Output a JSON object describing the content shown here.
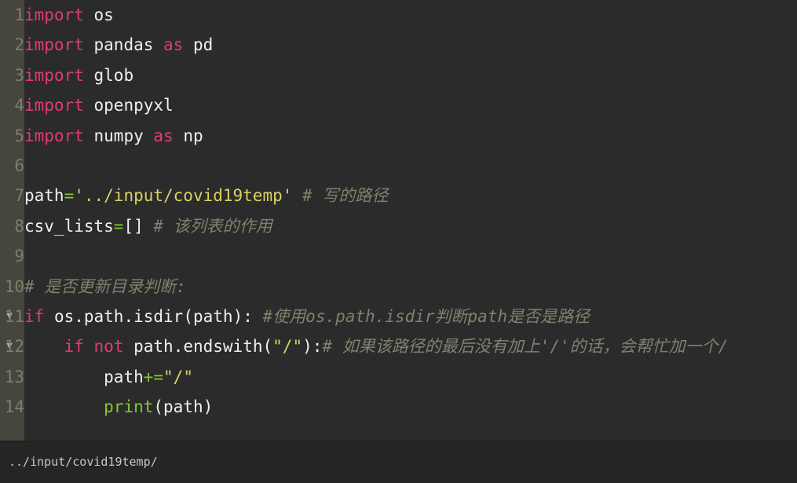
{
  "editor": {
    "language": "python",
    "theme": {
      "background": "#2b2b2b",
      "gutter_background": "#46453e",
      "line_number_color": "#7e7d6e",
      "default_text": "#e8e8e8",
      "keyword": "#e03c72",
      "string": "#d9d264",
      "operator": "#86c834",
      "function": "#86c834",
      "comment": "#82806e",
      "fold_arrow": "#b4b4b0"
    },
    "fold_arrow_glyph": "▼",
    "lines": [
      {
        "number": "1",
        "fold": false,
        "tokens": [
          {
            "t": "import",
            "c": "t-kw"
          },
          {
            "t": " ",
            "c": "t-id"
          },
          {
            "t": "os",
            "c": "t-id"
          }
        ]
      },
      {
        "number": "2",
        "fold": false,
        "tokens": [
          {
            "t": "import",
            "c": "t-kw"
          },
          {
            "t": " ",
            "c": "t-id"
          },
          {
            "t": "pandas",
            "c": "t-id"
          },
          {
            "t": " ",
            "c": "t-id"
          },
          {
            "t": "as",
            "c": "t-kw"
          },
          {
            "t": " ",
            "c": "t-id"
          },
          {
            "t": "pd",
            "c": "t-id"
          }
        ]
      },
      {
        "number": "3",
        "fold": false,
        "tokens": [
          {
            "t": "import",
            "c": "t-kw"
          },
          {
            "t": " ",
            "c": "t-id"
          },
          {
            "t": "glob",
            "c": "t-id"
          }
        ]
      },
      {
        "number": "4",
        "fold": false,
        "tokens": [
          {
            "t": "import",
            "c": "t-kw"
          },
          {
            "t": " ",
            "c": "t-id"
          },
          {
            "t": "openpyxl",
            "c": "t-id"
          }
        ]
      },
      {
        "number": "5",
        "fold": false,
        "tokens": [
          {
            "t": "import",
            "c": "t-kw"
          },
          {
            "t": " ",
            "c": "t-id"
          },
          {
            "t": "numpy",
            "c": "t-id"
          },
          {
            "t": " ",
            "c": "t-id"
          },
          {
            "t": "as",
            "c": "t-kw"
          },
          {
            "t": " ",
            "c": "t-id"
          },
          {
            "t": "np",
            "c": "t-id"
          }
        ]
      },
      {
        "number": "6",
        "fold": false,
        "tokens": []
      },
      {
        "number": "7",
        "fold": false,
        "tokens": [
          {
            "t": "path",
            "c": "t-id"
          },
          {
            "t": "=",
            "c": "t-op"
          },
          {
            "t": "'../input/covid19temp'",
            "c": "t-str"
          },
          {
            "t": " ",
            "c": "t-id"
          },
          {
            "t": "# 写的路径",
            "c": "t-com"
          }
        ]
      },
      {
        "number": "8",
        "fold": false,
        "tokens": [
          {
            "t": "csv_lists",
            "c": "t-id"
          },
          {
            "t": "=",
            "c": "t-op"
          },
          {
            "t": "[]",
            "c": "t-pun"
          },
          {
            "t": " ",
            "c": "t-id"
          },
          {
            "t": "# 该列表的作用",
            "c": "t-com"
          }
        ]
      },
      {
        "number": "9",
        "fold": false,
        "tokens": []
      },
      {
        "number": "10",
        "fold": false,
        "tokens": [
          {
            "t": "# 是否更新目录判断:",
            "c": "t-com"
          }
        ]
      },
      {
        "number": "11",
        "fold": true,
        "tokens": [
          {
            "t": "if",
            "c": "t-kw"
          },
          {
            "t": " ",
            "c": "t-id"
          },
          {
            "t": "os.path.isdir",
            "c": "t-id"
          },
          {
            "t": "(",
            "c": "t-pun"
          },
          {
            "t": "path",
            "c": "t-id"
          },
          {
            "t": ")",
            "c": "t-pun"
          },
          {
            "t": ":",
            "c": "t-pun"
          },
          {
            "t": " ",
            "c": "t-id"
          },
          {
            "t": "#使用os.path.isdir判断path是否是路径",
            "c": "t-com"
          }
        ]
      },
      {
        "number": "12",
        "fold": true,
        "tokens": [
          {
            "t": "    ",
            "c": "t-id"
          },
          {
            "t": "if",
            "c": "t-kw"
          },
          {
            "t": " ",
            "c": "t-id"
          },
          {
            "t": "not",
            "c": "t-kw"
          },
          {
            "t": " ",
            "c": "t-id"
          },
          {
            "t": "path.endswith",
            "c": "t-id"
          },
          {
            "t": "(",
            "c": "t-pun"
          },
          {
            "t": "\"/\"",
            "c": "t-str"
          },
          {
            "t": ")",
            "c": "t-pun"
          },
          {
            "t": ":",
            "c": "t-pun"
          },
          {
            "t": "# 如果该路径的最后没有加上'/'的话，会帮忙加一个/",
            "c": "t-com"
          }
        ]
      },
      {
        "number": "13",
        "fold": false,
        "tokens": [
          {
            "t": "        ",
            "c": "t-id"
          },
          {
            "t": "path",
            "c": "t-id"
          },
          {
            "t": "+=",
            "c": "t-op"
          },
          {
            "t": "\"/\"",
            "c": "t-str"
          }
        ]
      },
      {
        "number": "14",
        "fold": false,
        "tokens": [
          {
            "t": "        ",
            "c": "t-id"
          },
          {
            "t": "print",
            "c": "t-fn"
          },
          {
            "t": "(",
            "c": "t-pun"
          },
          {
            "t": "path",
            "c": "t-id"
          },
          {
            "t": ")",
            "c": "t-pun"
          }
        ]
      }
    ]
  },
  "output": {
    "text": "../input/covid19temp/"
  }
}
